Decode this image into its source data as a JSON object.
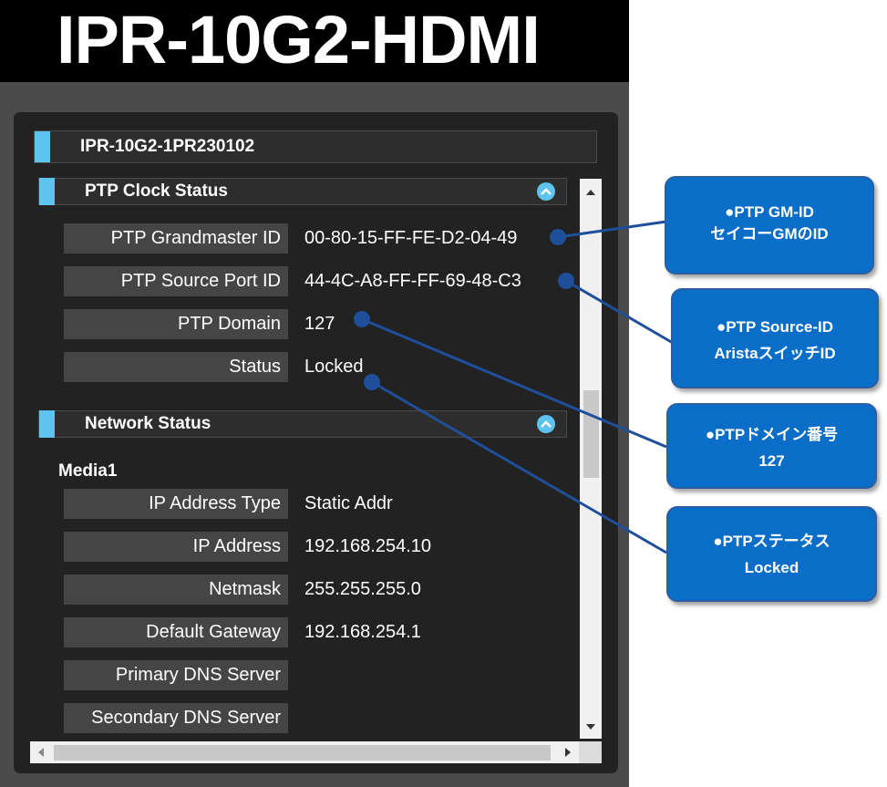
{
  "app": {
    "title": "IPR-10G2-HDMI"
  },
  "device": {
    "name": "IPR-10G2-1PR230102"
  },
  "sections": {
    "ptp": {
      "title": "PTP Clock Status",
      "rows": [
        {
          "label": "PTP Grandmaster ID",
          "value": "00-80-15-FF-FE-D2-04-49"
        },
        {
          "label": "PTP Source Port ID",
          "value": "44-4C-A8-FF-FF-69-48-C3"
        },
        {
          "label": "PTP Domain",
          "value": "127"
        },
        {
          "label": "Status",
          "value": "Locked"
        }
      ]
    },
    "network": {
      "title": "Network Status",
      "media_heading": "Media1",
      "rows": [
        {
          "label": "IP Address Type",
          "value": "Static Addr"
        },
        {
          "label": "IP Address",
          "value": "192.168.254.10"
        },
        {
          "label": "Netmask",
          "value": "255.255.255.0"
        },
        {
          "label": "Default Gateway",
          "value": "192.168.254.1"
        },
        {
          "label": "Primary DNS Server",
          "value": ""
        },
        {
          "label": "Secondary DNS Server",
          "value": ""
        }
      ]
    }
  },
  "callouts": [
    {
      "line1": "●PTP GM-ID",
      "line2": "セイコーGMのID"
    },
    {
      "line1": "●PTP Source-ID",
      "line2": "AristaスイッチID"
    },
    {
      "line1": "●PTPドメイン番号",
      "line2": "127"
    },
    {
      "line1": "●PTPステータス",
      "line2": "Locked"
    }
  ],
  "colors": {
    "accent": "#5dc3ef",
    "callout_fill": "#0a6ec8",
    "connector": "#1f4f9a"
  },
  "icons": {
    "collapse": "chevron-up-icon",
    "scroll_up": "triangle-up-icon",
    "scroll_down": "triangle-down-icon",
    "scroll_left": "triangle-left-icon",
    "scroll_right": "triangle-right-icon"
  }
}
